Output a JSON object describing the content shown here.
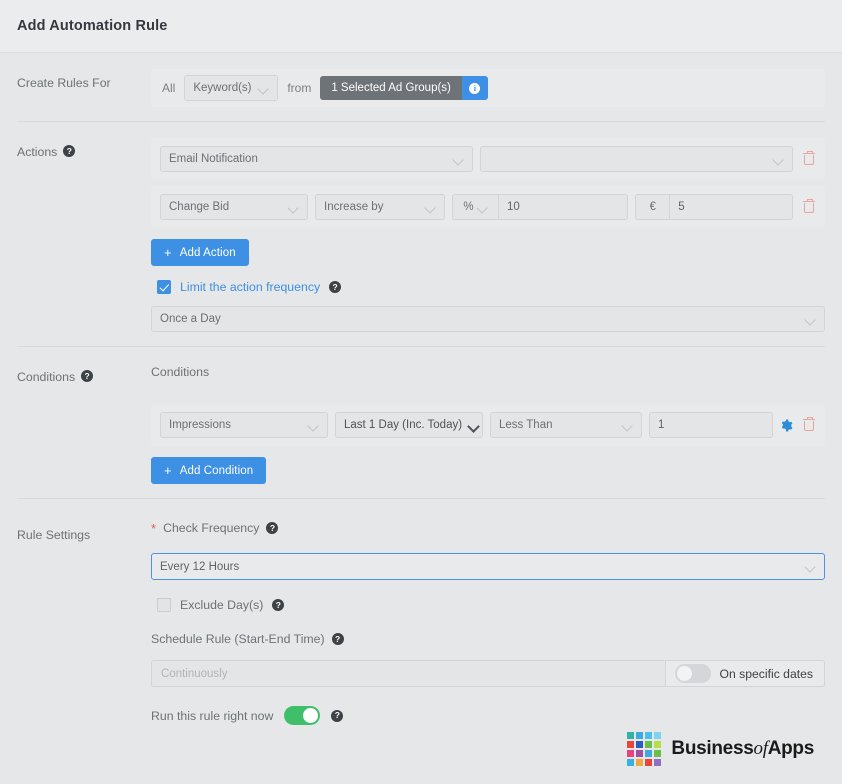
{
  "window": {
    "title": "Add Automation Rule"
  },
  "create_rules": {
    "label": "Create Rules For",
    "all_text": "All",
    "entity_select": "Keyword(s)",
    "from_text": "from",
    "badge_text": "1 Selected Ad Group(s)",
    "info_icon": "info-icon"
  },
  "actions": {
    "label": "Actions",
    "rows": [
      {
        "type_select": "Email Notification",
        "target_select": "",
        "target_placeholder": ""
      },
      {
        "type_select": "Change Bid",
        "direction_select": "Increase by",
        "unit_select": "%",
        "amount_value": "10",
        "currency_prefix": "€",
        "currency_value": "5"
      }
    ],
    "add_button": "Add Action",
    "limit_checkbox_label": "Limit the action frequency",
    "limit_checked": true,
    "frequency_select": "Once a Day"
  },
  "conditions": {
    "label": "Conditions",
    "sub_label": "Conditions",
    "rows": [
      {
        "metric_select": "Impressions",
        "range_select": "Last 1 Day (Inc. Today)",
        "operator_select": "Less Than",
        "value": "1"
      }
    ],
    "add_button": "Add Condition"
  },
  "rule_settings": {
    "label": "Rule Settings",
    "check_frequency_label": "Check Frequency",
    "check_frequency_required": "*",
    "check_frequency_value": "Every 12 Hours",
    "exclude_days_label": "Exclude Day(s)",
    "exclude_days_checked": false,
    "schedule_label": "Schedule Rule (Start-End Time)",
    "schedule_placeholder": "Continuously",
    "specific_dates_label": "On specific dates",
    "specific_dates_on": false,
    "run_now_label": "Run this rule right now",
    "run_now_on": true
  },
  "footer": {
    "brand_business": "Business",
    "brand_of": "of",
    "brand_apps": "Apps",
    "logo_colors": [
      "#2fb3a8",
      "#3fa9e0",
      "#4dc0ea",
      "#7fd3f0",
      "#e8453c",
      "#2a5fc0",
      "#6ac04a",
      "#b8dd4a",
      "#e8427f",
      "#a34fa0",
      "#3fa9e0",
      "#6ac04a",
      "#39b0e5",
      "#f0a93c",
      "#e8453c",
      "#8e6fc4"
    ]
  }
}
